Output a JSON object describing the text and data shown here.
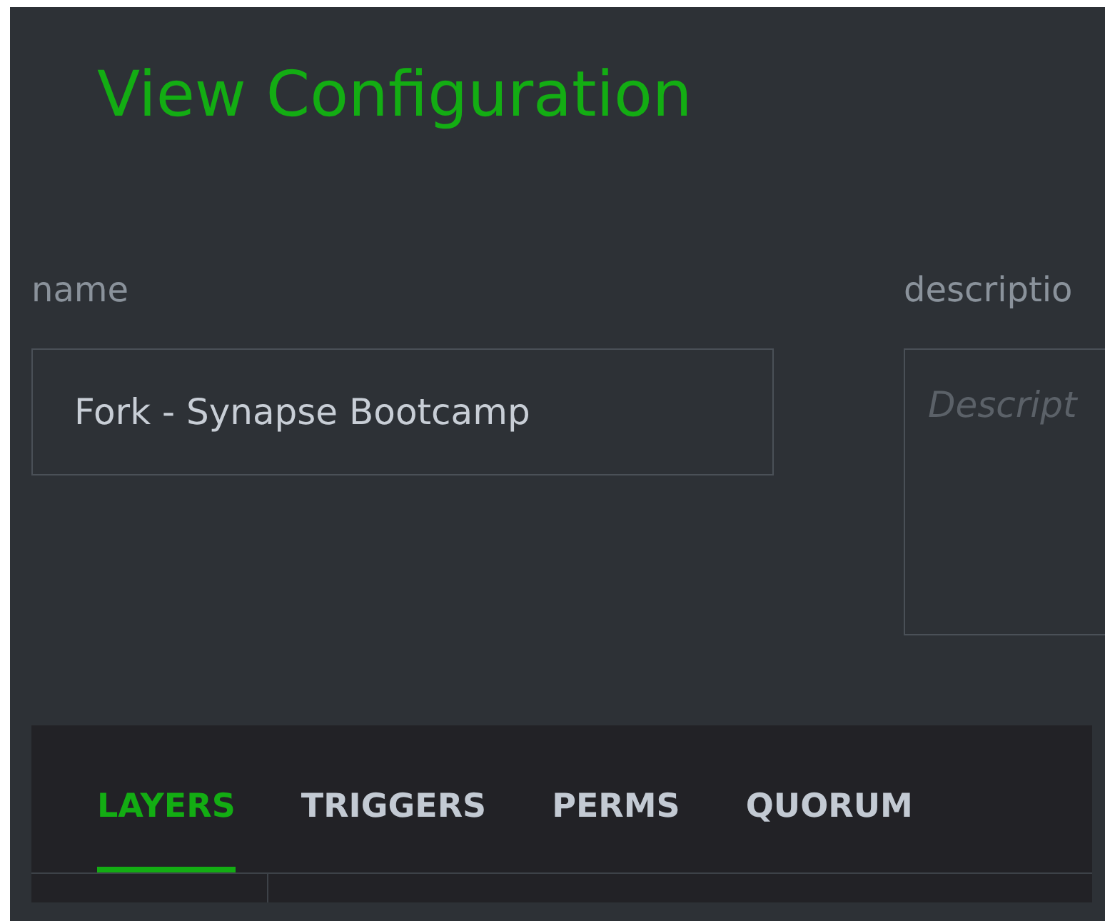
{
  "title": "View Configuration",
  "fields": [
    {
      "label": "name",
      "kind": "input",
      "value": "Fork - Synapse Bootcamp"
    },
    {
      "label": "descriptio",
      "kind": "textarea",
      "placeholder": "Descript"
    }
  ],
  "tabs": [
    {
      "label": "LAYERS",
      "selected": true
    },
    {
      "label": "TRIGGERS",
      "selected": false
    },
    {
      "label": "PERMS",
      "selected": false
    },
    {
      "label": "QUORUM",
      "selected": false
    }
  ]
}
